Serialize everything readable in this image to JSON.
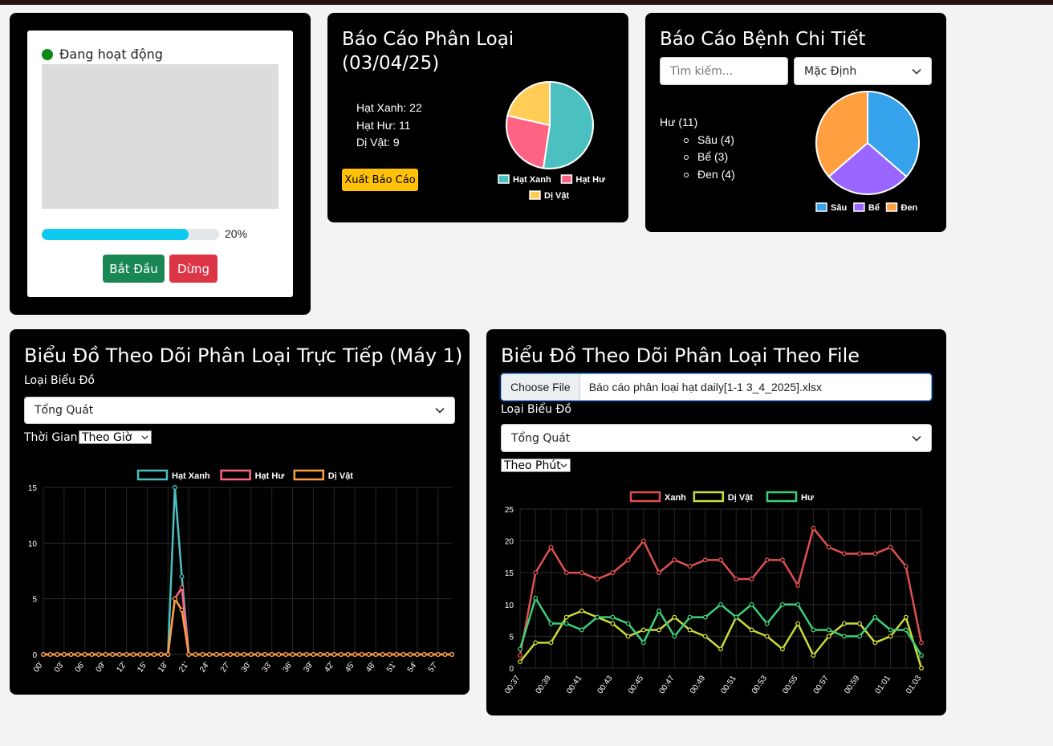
{
  "camera_panel": {
    "status_text": "Đang hoạt động",
    "status_color": "#0a8a14",
    "progress_percent": 20,
    "progress_bar_fill_fraction": 0.83,
    "progress_label": "20%",
    "start_label": "Bắt Đầu",
    "stop_label": "Dừng"
  },
  "classification_report": {
    "title": "Báo Cáo Phân Loại (03/04/25)",
    "lines": [
      "Hạt Xanh: 22",
      "Hạt Hư: 11",
      "Dị Vật: 9"
    ],
    "export_label": "Xuất Báo Cáo"
  },
  "disease_report": {
    "title": "Báo Cáo Bệnh Chi Tiết",
    "search_placeholder": "Tìm kiếm...",
    "sort_selected": "Mặc Định",
    "group_label": "Hư (11)",
    "items": [
      "Sâu (4)",
      "Bể (3)",
      "Đen (4)"
    ]
  },
  "live_chart_panel": {
    "title": "Biểu Đồ Theo Dõi Phân Loại Trực Tiếp (Máy 1)",
    "chart_type_label": "Loại Biểu Đồ",
    "chart_type_selected": "Tổng Quát",
    "time_label": "Thời Gian",
    "time_selected": "Theo Giờ"
  },
  "file_chart_panel": {
    "title": "Biểu Đồ Theo Dõi Phân Loại Theo File",
    "file_button": "Choose File",
    "file_name": "Báo cáo phân loại hạt daily[1-1 3_4_2025].xlsx",
    "chart_type_label": "Loại Biểu Đồ",
    "chart_type_selected": "Tổng Quát",
    "time_selected": "Theo Phút"
  },
  "chart_data": [
    {
      "type": "pie",
      "labels": [
        "Hạt Xanh",
        "Hạt Hư",
        "Dị Vật"
      ],
      "values": [
        22,
        11,
        9
      ],
      "colors": [
        "#4bc0c0",
        "#ff6384",
        "#ffcd56"
      ],
      "legend": "bottom"
    },
    {
      "type": "pie",
      "labels": [
        "Sâu",
        "Bể",
        "Đen"
      ],
      "values": [
        4,
        3,
        4
      ],
      "colors": [
        "#36a2eb",
        "#9966ff",
        "#ff9f40"
      ],
      "legend": "bottom"
    },
    {
      "type": "line",
      "x": [
        "00'",
        "01'",
        "02'",
        "03'",
        "04'",
        "05'",
        "06'",
        "07'",
        "08'",
        "09'",
        "10'",
        "11'",
        "12'",
        "13'",
        "14'",
        "15'",
        "16'",
        "17'",
        "18'",
        "19'",
        "20'",
        "21'",
        "22'",
        "23'",
        "24'",
        "25'",
        "26'",
        "27'",
        "28'",
        "29'",
        "30'",
        "31'",
        "32'",
        "33'",
        "34'",
        "35'",
        "36'",
        "37'",
        "38'",
        "39'",
        "40'",
        "41'",
        "42'",
        "43'",
        "44'",
        "45'",
        "46'",
        "47'",
        "48'",
        "49'",
        "50'",
        "51'",
        "52'",
        "53'",
        "54'",
        "55'",
        "56'",
        "57'",
        "58'",
        "59'"
      ],
      "tick_labels": [
        "00'",
        "03'",
        "06'",
        "09'",
        "12'",
        "15'",
        "18'",
        "21'",
        "24'",
        "27'",
        "30'",
        "33'",
        "36'",
        "39'",
        "42'",
        "45'",
        "48'",
        "51'",
        "54'",
        "57'"
      ],
      "series": [
        {
          "name": "Hạt Xanh",
          "color": "#4bc0c0",
          "values": [
            0,
            0,
            0,
            0,
            0,
            0,
            0,
            0,
            0,
            0,
            0,
            0,
            0,
            0,
            0,
            0,
            0,
            0,
            0,
            15,
            7,
            0,
            0,
            0,
            0,
            0,
            0,
            0,
            0,
            0,
            0,
            0,
            0,
            0,
            0,
            0,
            0,
            0,
            0,
            0,
            0,
            0,
            0,
            0,
            0,
            0,
            0,
            0,
            0,
            0,
            0,
            0,
            0,
            0,
            0,
            0,
            0,
            0,
            0,
            0
          ]
        },
        {
          "name": "Hạt Hư",
          "color": "#ff6384",
          "values": [
            0,
            0,
            0,
            0,
            0,
            0,
            0,
            0,
            0,
            0,
            0,
            0,
            0,
            0,
            0,
            0,
            0,
            0,
            0,
            5,
            6,
            0,
            0,
            0,
            0,
            0,
            0,
            0,
            0,
            0,
            0,
            0,
            0,
            0,
            0,
            0,
            0,
            0,
            0,
            0,
            0,
            0,
            0,
            0,
            0,
            0,
            0,
            0,
            0,
            0,
            0,
            0,
            0,
            0,
            0,
            0,
            0,
            0,
            0,
            0
          ]
        },
        {
          "name": "Dị Vật",
          "color": "#ff9f40",
          "values": [
            0,
            0,
            0,
            0,
            0,
            0,
            0,
            0,
            0,
            0,
            0,
            0,
            0,
            0,
            0,
            0,
            0,
            0,
            0,
            5,
            4,
            0,
            0,
            0,
            0,
            0,
            0,
            0,
            0,
            0,
            0,
            0,
            0,
            0,
            0,
            0,
            0,
            0,
            0,
            0,
            0,
            0,
            0,
            0,
            0,
            0,
            0,
            0,
            0,
            0,
            0,
            0,
            0,
            0,
            0,
            0,
            0,
            0,
            0,
            0
          ]
        }
      ],
      "ylim": [
        0,
        15
      ],
      "yticks": [
        0,
        5,
        10,
        15
      ],
      "legend": "top",
      "grid": true
    },
    {
      "type": "line",
      "x": [
        "00:37",
        "00:38",
        "00:39",
        "00:40",
        "00:41",
        "00:42",
        "00:43",
        "00:44",
        "00:45",
        "00:46",
        "00:47",
        "00:48",
        "00:49",
        "00:50",
        "00:51",
        "00:52",
        "00:53",
        "00:54",
        "00:55",
        "00:56",
        "00:57",
        "00:58",
        "00:59",
        "01:00",
        "01:01",
        "01:02",
        "01:03"
      ],
      "tick_labels": [
        "00:37",
        "00:39",
        "00:41",
        "00:43",
        "00:45",
        "00:47",
        "00:49",
        "00:51",
        "00:53",
        "00:55",
        "00:57",
        "00:59",
        "01:01",
        "01:03"
      ],
      "series": [
        {
          "name": "Xanh",
          "color": "#e05050",
          "values": [
            2,
            15,
            19,
            15,
            15,
            14,
            15,
            17,
            20,
            15,
            17,
            16,
            17,
            17,
            14,
            14,
            17,
            17,
            13,
            22,
            19,
            18,
            18,
            18,
            19,
            16,
            4
          ]
        },
        {
          "name": "Dị Vật",
          "color": "#cddc39",
          "values": [
            1,
            4,
            4,
            8,
            9,
            8,
            7,
            5,
            6,
            6,
            8,
            6,
            5,
            3,
            8,
            6,
            5,
            3,
            7,
            2,
            5,
            7,
            7,
            4,
            5,
            8,
            0
          ]
        },
        {
          "name": "Hư",
          "color": "#3dd07a",
          "values": [
            3,
            11,
            7,
            7,
            6,
            8,
            8,
            7,
            4,
            9,
            5,
            8,
            8,
            10,
            8,
            10,
            7,
            10,
            10,
            6,
            6,
            5,
            5,
            8,
            6,
            6,
            2
          ]
        }
      ],
      "ylim": [
        0,
        25
      ],
      "yticks": [
        0,
        5,
        10,
        15,
        20,
        25
      ],
      "legend": "top",
      "grid": true
    }
  ]
}
